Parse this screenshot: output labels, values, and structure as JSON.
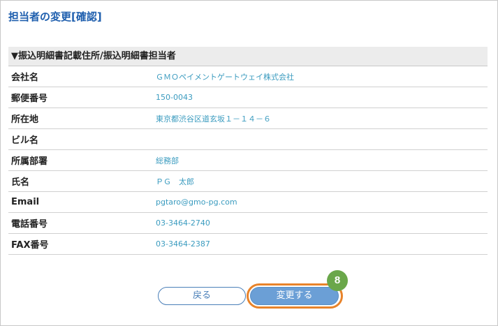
{
  "page": {
    "title": "担当者の変更[確認]"
  },
  "section": {
    "header": "▼振込明細書記載住所/振込明細書担当者"
  },
  "rows": [
    {
      "label": "会社名",
      "value": "ＧＭＯペイメントゲートウェイ株式会社"
    },
    {
      "label": "郵便番号",
      "value": "150-0043"
    },
    {
      "label": "所在地",
      "value": "東京都渋谷区道玄坂１－１４－６"
    },
    {
      "label": "ビル名",
      "value": ""
    },
    {
      "label": "所属部署",
      "value": "総務部"
    },
    {
      "label": "氏名",
      "value": "ＰＧ　太郎"
    },
    {
      "label": "Email",
      "value": "pgtaro@gmo-pg.com"
    },
    {
      "label": "電話番号",
      "value": "03-3464-2740"
    },
    {
      "label": "FAX番号",
      "value": "03-3464-2387"
    }
  ],
  "buttons": {
    "back_label": "戻る",
    "submit_label": "変更する"
  },
  "annotation": {
    "step_number": "8",
    "highlight_color": "#e8832a",
    "badge_color": "#6aa74a"
  },
  "colors": {
    "title": "#1f5fae",
    "value_text": "#3a9bbf",
    "submit_bg": "#6b9fd6"
  }
}
